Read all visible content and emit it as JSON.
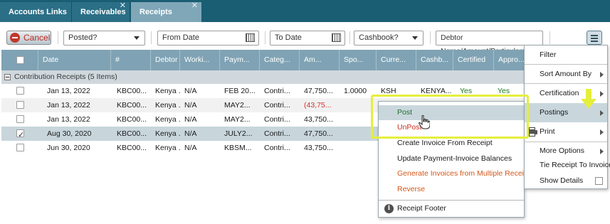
{
  "tabs": [
    {
      "label": "Accounts Links",
      "closable": false,
      "active": false
    },
    {
      "label": "Receivables",
      "closable": true,
      "active": false
    },
    {
      "label": "Receipts",
      "closable": true,
      "active": true
    }
  ],
  "toolbar": {
    "cancel_label": "Cancel",
    "posted_value": "Posted?",
    "from_date_placeholder": "From Date",
    "to_date_placeholder": "To Date",
    "cashbook_value": "Cashbook?",
    "search_placeholder": "Debtor Name/Amount/Particulars"
  },
  "columns": [
    "Date",
    "#",
    "Debtor",
    "Worki...",
    "Paym...",
    "Categ...",
    "Am...",
    "Spo...",
    "Curre...",
    "Cashb...",
    "Certified",
    "Appro..."
  ],
  "group": {
    "label": "Contribution Receipts (5 Items)"
  },
  "rows": [
    {
      "checked": false,
      "selected": false,
      "date": "Jan 13, 2022",
      "num": "KBC00...",
      "debtor": "Kenya ...",
      "working": "N/A",
      "payment": "FEB 20...",
      "category": "Contri...",
      "amount": "47,750...",
      "negative": false,
      "spot": "1.0000",
      "currency": "KSH",
      "cashbook": "KENYA...",
      "certified": "Yes",
      "approved": "Yes"
    },
    {
      "checked": false,
      "selected": false,
      "date": "Jan 13, 2022",
      "num": "KBC00...",
      "debtor": "Kenya ...",
      "working": "N/A",
      "payment": "MAY2...",
      "category": "Contri...",
      "amount": "(43,75...",
      "negative": true,
      "spot": "",
      "currency": "",
      "cashbook": "",
      "certified": "",
      "approved": ""
    },
    {
      "checked": false,
      "selected": false,
      "date": "Jan 13, 2022",
      "num": "KBC00...",
      "debtor": "Kenya ...",
      "working": "N/A",
      "payment": "MAY2...",
      "category": "Contri...",
      "amount": "43,750...",
      "negative": false,
      "spot": "",
      "currency": "",
      "cashbook": "",
      "certified": "",
      "approved": ""
    },
    {
      "checked": true,
      "selected": true,
      "date": "Aug 30, 2020",
      "num": "KBC00...",
      "debtor": "Kenya ...",
      "working": "N/A",
      "payment": "JULY2...",
      "category": "Contri...",
      "amount": "47,750...",
      "negative": false,
      "spot": "",
      "currency": "",
      "cashbook": "",
      "certified": "",
      "approved": ""
    },
    {
      "checked": false,
      "selected": false,
      "date": "Jun 30, 2020",
      "num": "KBC00...",
      "debtor": "Kenya ...",
      "working": "N/A",
      "payment": "KBSM...",
      "category": "Contri...",
      "amount": "43,750...",
      "negative": false,
      "spot": "",
      "currency": "",
      "cashbook": "",
      "certified": "",
      "approved": ""
    }
  ],
  "right_menu": {
    "items": [
      {
        "label": "Filter",
        "submenu": false
      },
      {
        "label": "Sort Amount By",
        "submenu": true
      },
      {
        "label": "Certification",
        "submenu": true
      },
      {
        "label": "Postings",
        "submenu": true,
        "highlighted": true
      },
      {
        "label": "Print",
        "submenu": true,
        "icon": "printer-icon"
      },
      {
        "label": "More Options",
        "submenu": true
      },
      {
        "label": "Tie Receipt To Invoice",
        "submenu": false
      },
      {
        "label": "Show Details",
        "submenu": false,
        "checkbox": true
      }
    ]
  },
  "postings_menu": {
    "items": [
      {
        "label": "Post",
        "color": "#1e6f2a",
        "highlighted": true
      },
      {
        "label": "UnPost",
        "color": "#cc2b1d"
      },
      {
        "label": "Create Invoice From Receipt",
        "color": "#1a1a1a"
      },
      {
        "label": "Update Payment-Invoice Balances",
        "color": "#1a1a1a"
      },
      {
        "label": "Generate Invoices from Multiple Receipts",
        "color": "#d4571b"
      },
      {
        "label": "Reverse",
        "color": "#d4571b"
      },
      {
        "label": "Receipt Footer",
        "color": "#1a1a1a",
        "icon": "info-icon"
      }
    ]
  },
  "colors": {
    "tabbar": "#1a5e74",
    "table_header": "#7fa3b4",
    "highlight": "#c9d7dd",
    "annotation": "#e6ee3c"
  }
}
